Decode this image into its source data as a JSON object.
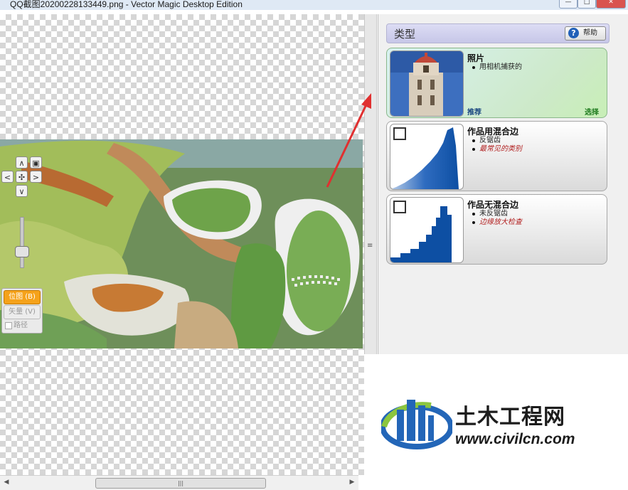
{
  "window": {
    "title": "QQ截图20200228133449.png - Vector Magic Desktop Edition",
    "controls": [
      "minimize",
      "maximize",
      "close"
    ]
  },
  "viewer": {
    "nav_buttons": {
      "up": "∧",
      "left": "<",
      "right": ">",
      "down": "∨"
    },
    "modes": {
      "bitmap": "位图 (B)",
      "vector": "矢量 (V)",
      "paths": "路径"
    },
    "selected_mode": "bitmap",
    "scrollbar_grip": "|||"
  },
  "sidebar": {
    "heading": "类型",
    "help_label": "帮助",
    "cards": [
      {
        "title": "照片",
        "bullets": [
          "用相机捕获的"
        ],
        "recommend": "推荐",
        "select": "选择",
        "selected": true
      },
      {
        "title": "作品用混合边",
        "bullets": [
          "反锯齿",
          "最常见的类别"
        ]
      },
      {
        "title": "作品无混合边",
        "bullets": [
          "未反锯齿",
          "边缘放大检查"
        ]
      }
    ]
  },
  "watermark": {
    "brand": "土木工程网",
    "url": "www.civilcn.com"
  },
  "colors": {
    "accent_orange": "#f5a21a",
    "selected_card": "#cde9c9",
    "arrow_red": "#e03030",
    "chart_blue": "#0d4fa3"
  }
}
